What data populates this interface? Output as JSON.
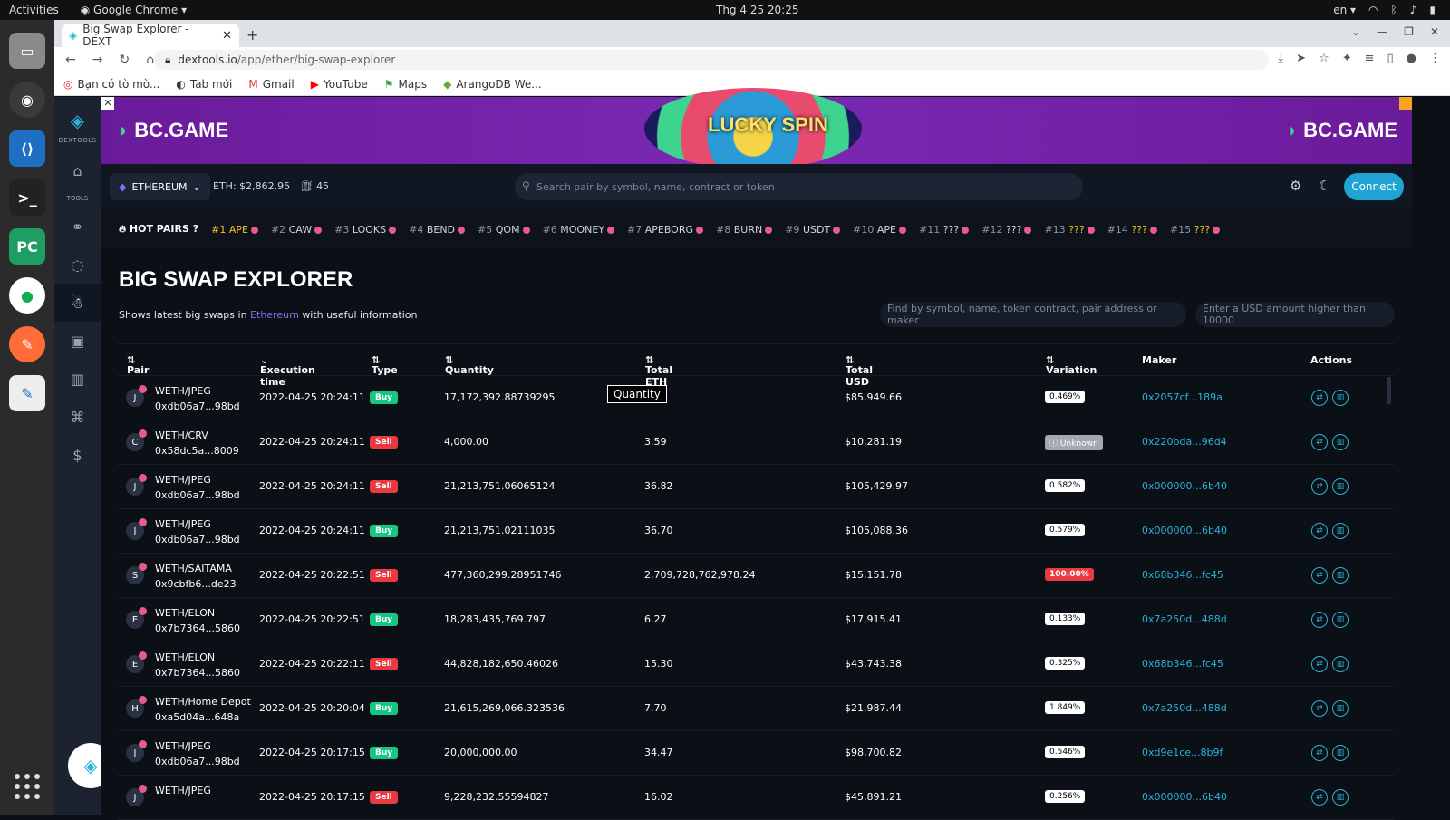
{
  "os": {
    "activities": "Activities",
    "app": "Google Chrome",
    "clock": "Thg 4 25  20:25",
    "lang": "en"
  },
  "browser": {
    "tab_title": "Big Swap Explorer - DEXT",
    "url_host": "dextools.io",
    "url_path": "/app/ether/big-swap-explorer",
    "bookmarks": [
      "Bạn có tò mò...",
      "Tab mới",
      "Gmail",
      "YouTube",
      "Maps",
      "ArangoDB We..."
    ]
  },
  "sidebar": {
    "brand": "DEXTOOLS",
    "tools_label": "TOOLS"
  },
  "banner": {
    "brand_left": "BC.GAME",
    "brand_right": "BC.GAME",
    "promo": "LUCKY SPIN"
  },
  "appbar": {
    "chain": "ETHEREUM",
    "eth_price": "ETH: $2,862.95",
    "gas": "45",
    "search_placeholder": "Search pair by symbol, name, contract or token",
    "connect": "Connect"
  },
  "hotpairs": {
    "label": "HOT PAIRS",
    "items": [
      {
        "rank": "#1",
        "sym": "APE"
      },
      {
        "rank": "#2",
        "sym": "CAW"
      },
      {
        "rank": "#3",
        "sym": "LOOKS"
      },
      {
        "rank": "#4",
        "sym": "BEND"
      },
      {
        "rank": "#5",
        "sym": "QOM"
      },
      {
        "rank": "#6",
        "sym": "MOONEY"
      },
      {
        "rank": "#7",
        "sym": "APEBORG"
      },
      {
        "rank": "#8",
        "sym": "BURN"
      },
      {
        "rank": "#9",
        "sym": "USDT"
      },
      {
        "rank": "#10",
        "sym": "APE"
      },
      {
        "rank": "#11",
        "sym": "???"
      },
      {
        "rank": "#12",
        "sym": "???"
      },
      {
        "rank": "#13",
        "sym": "???"
      },
      {
        "rank": "#14",
        "sym": "???"
      },
      {
        "rank": "#15",
        "sym": "???"
      }
    ]
  },
  "page": {
    "title": "BIG SWAP EXPLORER",
    "subtitle_pre": "Shows latest big swaps in",
    "subtitle_hl": "Ethereum",
    "subtitle_post": "with useful information",
    "filter_placeholder": "Find by symbol, name, token contract, pair address or maker",
    "usd_placeholder": "Enter a USD amount higher than 10000",
    "tooltip": "Quantity"
  },
  "table": {
    "headers": {
      "pair": "Pair",
      "time": "Execution time",
      "type": "Type",
      "qty": "Quantity",
      "eth": "Total ETH",
      "usd": "Total USD",
      "var": "Variation",
      "maker": "Maker",
      "actions": "Actions"
    },
    "rows": [
      {
        "av": "J",
        "pair": "WETH/JPEG",
        "addr": "0xdb06a7...98bd",
        "time": "2022-04-25 20:24:11",
        "type": "Buy",
        "qty": "17,172,392.88739295",
        "eth": "",
        "usd": "$85,949.66",
        "var": "0.469%",
        "maker": "0x2057cf...189a"
      },
      {
        "av": "C",
        "pair": "WETH/CRV",
        "addr": "0x58dc5a...8009",
        "time": "2022-04-25 20:24:11",
        "type": "Sell",
        "qty": "4,000.00",
        "eth": "3.59",
        "usd": "$10,281.19",
        "var": "Unknown",
        "maker": "0x220bda...96d4"
      },
      {
        "av": "J",
        "pair": "WETH/JPEG",
        "addr": "0xdb06a7...98bd",
        "time": "2022-04-25 20:24:11",
        "type": "Sell",
        "qty": "21,213,751.06065124",
        "eth": "36.82",
        "usd": "$105,429.97",
        "var": "0.582%",
        "maker": "0x000000...6b40"
      },
      {
        "av": "J",
        "pair": "WETH/JPEG",
        "addr": "0xdb06a7...98bd",
        "time": "2022-04-25 20:24:11",
        "type": "Buy",
        "qty": "21,213,751.02111035",
        "eth": "36.70",
        "usd": "$105,088.36",
        "var": "0.579%",
        "maker": "0x000000...6b40"
      },
      {
        "av": "S",
        "pair": "WETH/SAITAMA",
        "addr": "0x9cbfb6...de23",
        "time": "2022-04-25 20:22:51",
        "type": "Sell",
        "qty": "477,360,299.28951746",
        "eth": "2,709,728,762,978.24",
        "usd": "$15,151.78",
        "var": "100.00%",
        "maker": "0x68b346...fc45"
      },
      {
        "av": "E",
        "pair": "WETH/ELON",
        "addr": "0x7b7364...5860",
        "time": "2022-04-25 20:22:51",
        "type": "Buy",
        "qty": "18,283,435,769.797",
        "eth": "6.27",
        "usd": "$17,915.41",
        "var": "0.133%",
        "maker": "0x7a250d...488d"
      },
      {
        "av": "E",
        "pair": "WETH/ELON",
        "addr": "0x7b7364...5860",
        "time": "2022-04-25 20:22:11",
        "type": "Sell",
        "qty": "44,828,182,650.46026",
        "eth": "15.30",
        "usd": "$43,743.38",
        "var": "0.325%",
        "maker": "0x68b346...fc45"
      },
      {
        "av": "H",
        "pair": "WETH/Home Depot",
        "addr": "0xa5d04a...648a",
        "time": "2022-04-25 20:20:04",
        "type": "Buy",
        "qty": "21,615,269,066.323536",
        "eth": "7.70",
        "usd": "$21,987.44",
        "var": "1.849%",
        "maker": "0x7a250d...488d"
      },
      {
        "av": "J",
        "pair": "WETH/JPEG",
        "addr": "0xdb06a7...98bd",
        "time": "2022-04-25 20:17:15",
        "type": "Buy",
        "qty": "20,000,000.00",
        "eth": "34.47",
        "usd": "$98,700.82",
        "var": "0.546%",
        "maker": "0xd9e1ce...8b9f"
      },
      {
        "av": "J",
        "pair": "WETH/JPEG",
        "addr": "",
        "time": "2022-04-25 20:17:15",
        "type": "Sell",
        "qty": "9,228,232.55594827",
        "eth": "16.02",
        "usd": "$45,891.21",
        "var": "0.256%",
        "maker": "0x000000...6b40"
      }
    ]
  },
  "colors": {
    "accent": "#2bb3d8",
    "buy": "#16c784",
    "sell": "#ea3943",
    "bg": "#0b0f16"
  }
}
